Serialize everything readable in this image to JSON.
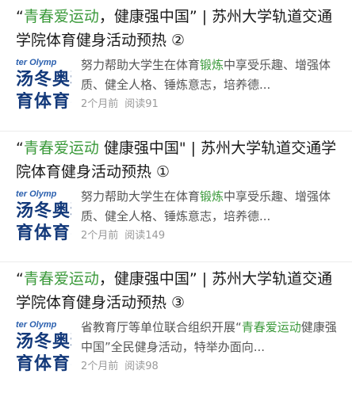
{
  "articles": [
    {
      "title_pre": "“",
      "title_hl": "青春爱运动",
      "title_post": "，健康强中国” | 苏州大学轨道交通学院体育健身活动预热 ②",
      "thumb": {
        "line1": "ter Olymp",
        "line2": "汤冬奥精",
        "line3": "育体育弘"
      },
      "summary_pre": "努力帮助大学生在体育",
      "summary_hl": "锻炼",
      "summary_post": "中享受乐趣、增强体质、健全人格、锤炼意志，培养德...",
      "time": "2个月前",
      "reads": "阅读91"
    },
    {
      "title_pre": "“",
      "title_hl": "青春爱运动",
      "title_post": " 健康强中国\" | 苏州大学轨道交通学院体育健身活动预热 ①",
      "thumb": {
        "line1": "ter Olymp",
        "line2": "汤冬奥精",
        "line3": "育体育弘"
      },
      "summary_pre": "努力帮助大学生在体育",
      "summary_hl": "锻炼",
      "summary_post": "中享受乐趣、增强体质、健全人格、锤炼意志，培养德...",
      "time": "2个月前",
      "reads": "阅读149"
    },
    {
      "title_pre": "“",
      "title_hl": "青春爱运动",
      "title_post": "，健康强中国” | 苏州大学轨道交通学院体育健身活动预热 ③",
      "thumb": {
        "line1": "ter Olymp",
        "line2": "汤冬奥精",
        "line3": "育体育弘"
      },
      "summary_pre": "省教育厅等单位联合组织开展“",
      "summary_hl": "青春爱运动",
      "summary_post": "健康强中国”全民健身活动，特举办面向...",
      "time": "2个月前",
      "reads": "阅读98"
    }
  ],
  "colors": {
    "highlight": "#3b9a3b",
    "meta": "#9a9a9a",
    "thumb_text": "#13397a"
  }
}
